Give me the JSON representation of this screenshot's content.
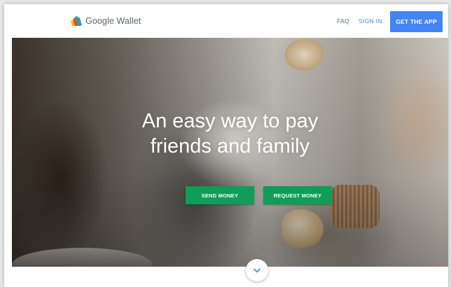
{
  "header": {
    "logo_text": "Google Wallet",
    "nav": {
      "faq": "FAQ",
      "sign_in": "SIGN IN",
      "get_app": "GET THE APP"
    }
  },
  "hero": {
    "title_line1": "An easy way to pay",
    "title_line2": "friends and family",
    "send_money": "SEND MONEY",
    "request_money": "REQUEST MONEY"
  },
  "icons": {
    "logo": "google-wallet-logo-icon",
    "scroll": "chevron-down-icon"
  },
  "colors": {
    "primary_blue": "#4285f4",
    "action_green": "#0f9d58",
    "text_gray": "#5f6368"
  }
}
